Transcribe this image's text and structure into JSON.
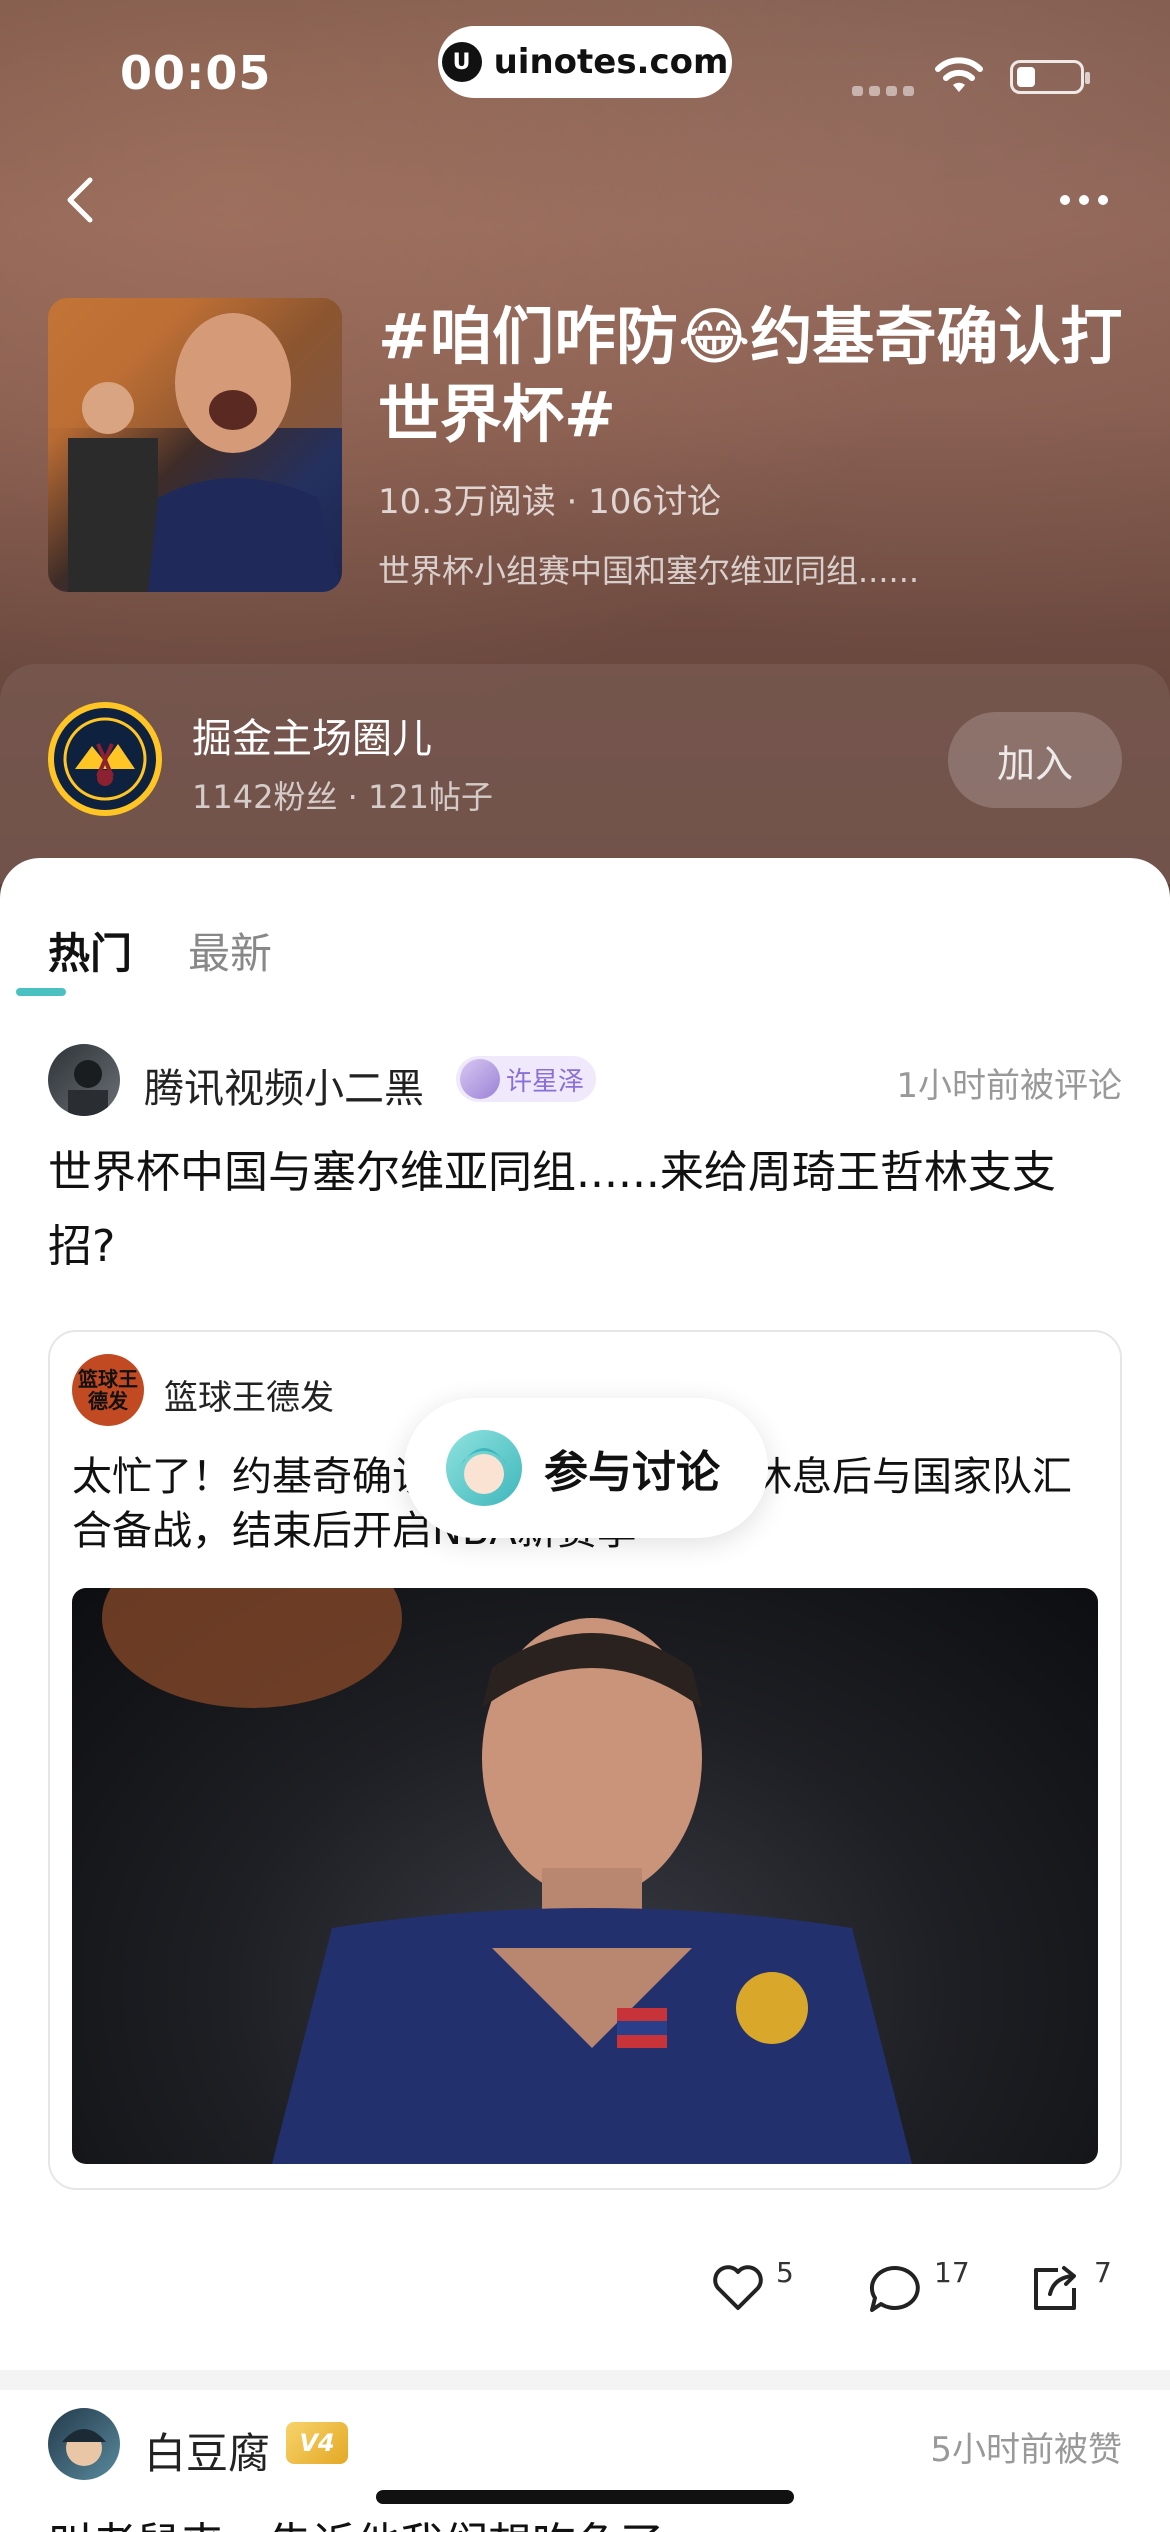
{
  "status_bar": {
    "time": "00:05",
    "url_pill": "uinotes.com",
    "url_logo": "U"
  },
  "nav": {
    "back_icon": "chevron-left-icon",
    "more_icon": "more-dots-icon"
  },
  "topic": {
    "title": "#咱们咋防😂约基奇确认打世界杯#",
    "stats": "10.3万阅读 · 106讨论",
    "description": "世界杯小组赛中国和塞尔维亚同组......"
  },
  "circle": {
    "name": "掘金主场圈儿",
    "stats": "1142粉丝 · 121帖子",
    "join_label": "加入"
  },
  "tabs": [
    {
      "label": "热门",
      "active": true
    },
    {
      "label": "最新",
      "active": false
    }
  ],
  "posts": [
    {
      "author": "腾讯视频小二黑",
      "badge": "许星泽",
      "time": "1小时前被评论",
      "text": "世界杯中国与塞尔维亚同组......来给周琦王哲林支支招?",
      "quote": {
        "author": "篮球王德发",
        "avatar_text": "篮球王德发",
        "text": "太忙了！约基奇确认出战世界杯，短暂休息后与国家队汇合备战，结束后开启NBA新赛季"
      },
      "actions": {
        "likes": "5",
        "comments": "17",
        "shares": "7"
      }
    },
    {
      "author": "白豆腐",
      "badge": "V4",
      "time": "5小时前被赞",
      "text": "叫老鼠来，告诉他我们想吃鱼了"
    }
  ],
  "join_discussion": {
    "label": "参与讨论"
  },
  "colors": {
    "accent": "#4bc0c0",
    "hero_bg": "#845a4d",
    "badge_purple": "#8a6fd8"
  }
}
